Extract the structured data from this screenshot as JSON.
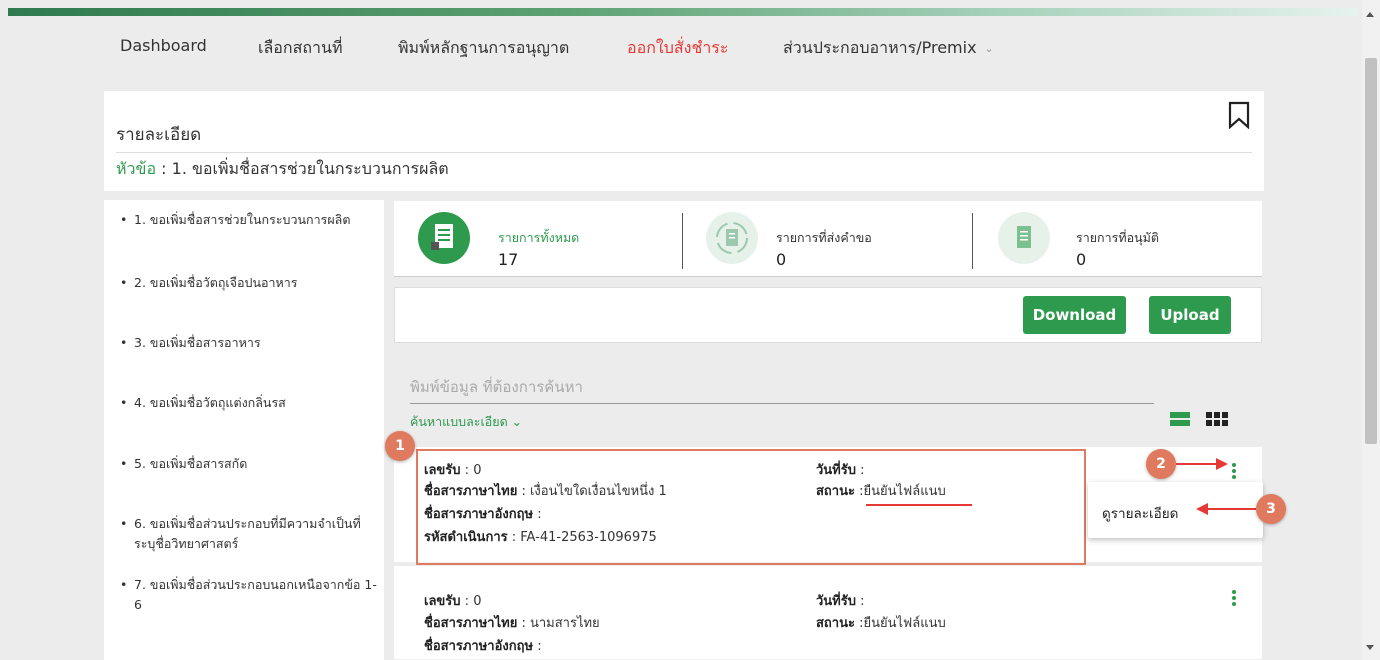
{
  "nav": {
    "items": [
      {
        "label": "Dashboard"
      },
      {
        "label": "เลือกสถานที่"
      },
      {
        "label": "พิมพ์หลักฐานการอนุญาต"
      },
      {
        "label": "ออกใบสั่งชำระ"
      },
      {
        "label": "ส่วนประกอบอาหาร/Premix"
      }
    ],
    "active_color": "#e53935",
    "dropdown_icon": "chevron-down-icon"
  },
  "detail": {
    "title": "รายละเอียด",
    "topic_label": "หัวข้อ",
    "topic_separator": " : ",
    "topic_value": "1. ขอเพิ่มชื่อสารช่วยในกระบวนการผลิต",
    "bookmark_icon": "bookmark-icon"
  },
  "sidebar": {
    "items": [
      {
        "label": "1. ขอเพิ่มชื่อสารช่วยในกระบวนการผลิต"
      },
      {
        "label": "2. ขอเพิ่มชื่อวัตถุเจือปนอาหาร"
      },
      {
        "label": "3. ขอเพิ่มชื่อสารอาหาร"
      },
      {
        "label": "4. ขอเพิ่มชื่อวัตถุแต่งกลิ่นรส"
      },
      {
        "label": "5. ขอเพิ่มชื่อสารสกัด"
      },
      {
        "label": "6. ขอเพิ่มชื่อส่วนประกอบที่มีความจำเป็นที่ระบุชื่อวิทยาศาสตร์"
      },
      {
        "label": "7. ขอเพิ่มชื่อส่วนประกอบนอกเหนือจากข้อ 1-6"
      }
    ]
  },
  "stats": [
    {
      "label": "รายการทั้งหมด",
      "value": "17",
      "label_color": "#2e9a4e",
      "icon": "document-icon"
    },
    {
      "label": "รายการที่ส่งคำขอ",
      "value": "0",
      "label_color": "#333333",
      "icon": "refresh-document-icon"
    },
    {
      "label": "รายการที่อนุมัติ",
      "value": "0",
      "label_color": "#333333",
      "icon": "approved-document-icon"
    }
  ],
  "actions": {
    "download_label": "Download",
    "upload_label": "Upload",
    "button_color": "#2e9a4e"
  },
  "search": {
    "placeholder": "พิมพ์ข้อมูล ที่ต้องการค้นหา",
    "advanced_label": "ค้นหาแบบละเอียด",
    "advanced_chevron": "⌄"
  },
  "records": [
    {
      "receipt_label": "เลขรับ",
      "receipt_value": "0",
      "thai_name_label": "ชื่อสารภาษาไทย",
      "thai_name_value": "เงื่อนไขใดเงื่อนไขหนึ่ง 1",
      "eng_name_label": "ชื่อสารภาษาอังกฤษ",
      "eng_name_value": "",
      "op_code_label": "รหัสดำเนินการ",
      "op_code_value": "FA-41-2563-1096975",
      "date_label": "วันที่รับ",
      "date_value": "",
      "status_label": "สถานะ",
      "status_value": "ยืนยันไฟล์แนบ"
    },
    {
      "receipt_label": "เลขรับ",
      "receipt_value": "0",
      "thai_name_label": "ชื่อสารภาษาไทย",
      "thai_name_value": "นามสารไทย",
      "eng_name_label": "ชื่อสารภาษาอังกฤษ",
      "eng_name_value": "",
      "date_label": "วันที่รับ",
      "date_value": "",
      "status_label": "สถานะ",
      "status_value": "ยืนยันไฟล์แนบ"
    }
  ],
  "popup": {
    "view_detail_label": "ดูรายละเอียด"
  },
  "annotations": {
    "badge_1": "1",
    "badge_2": "2",
    "badge_3": "3",
    "badge_color": "#e07a5f",
    "arrow_color": "#e53935"
  }
}
